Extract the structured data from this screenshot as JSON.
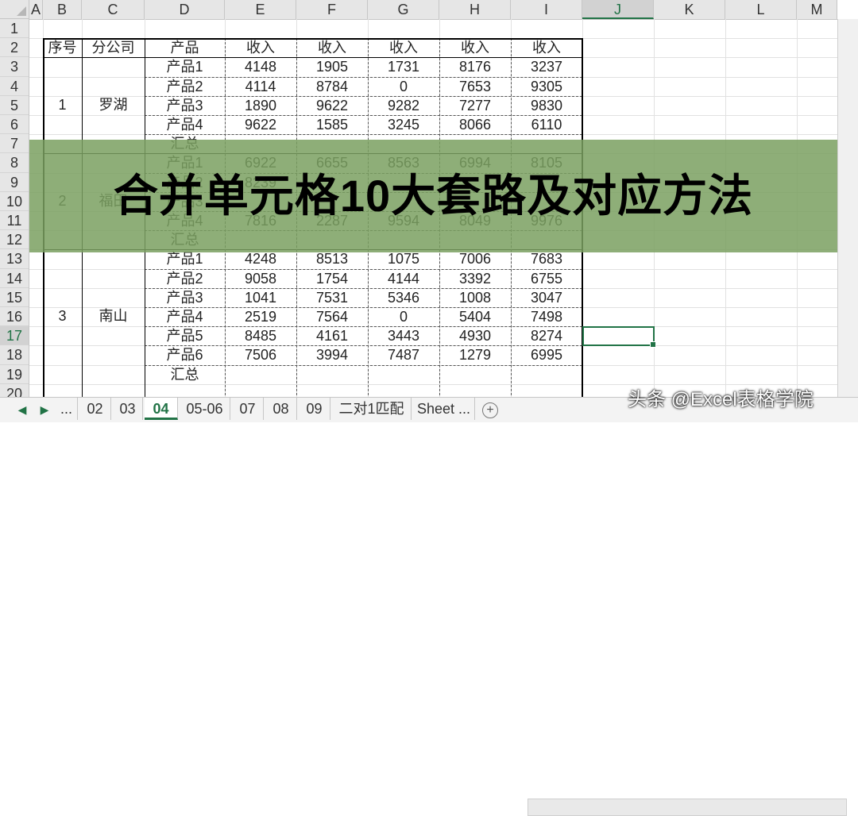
{
  "columns": [
    "A",
    "B",
    "C",
    "D",
    "E",
    "F",
    "G",
    "H",
    "I",
    "J",
    "K",
    "L",
    "M"
  ],
  "selected_column": "J",
  "rows": [
    "1",
    "2",
    "3",
    "4",
    "5",
    "6",
    "7",
    "8",
    "9",
    "10",
    "11",
    "12",
    "13",
    "14",
    "15",
    "16",
    "17",
    "18",
    "19",
    "20"
  ],
  "selected_row": "17",
  "table": {
    "headers": [
      "序号",
      "分公司",
      "产品",
      "收入",
      "收入",
      "收入",
      "收入",
      "收入"
    ],
    "groups": [
      {
        "seq": "1",
        "branch": "罗湖",
        "rows": [
          [
            "产品1",
            "4148",
            "1905",
            "1731",
            "8176",
            "3237"
          ],
          [
            "产品2",
            "4114",
            "8784",
            "0",
            "7653",
            "9305"
          ],
          [
            "产品3",
            "1890",
            "9622",
            "9282",
            "7277",
            "9830"
          ],
          [
            "产品4",
            "9622",
            "1585",
            "3245",
            "8066",
            "6110"
          ],
          [
            "汇总",
            "",
            "",
            "",
            "",
            ""
          ]
        ]
      },
      {
        "seq": "2",
        "branch": "福田",
        "rows": [
          [
            "产品1",
            "6922",
            "6655",
            "8563",
            "6994",
            "8105"
          ],
          [
            "产品2",
            "8239",
            "",
            "",
            "",
            ""
          ],
          [
            "产品3",
            "",
            "",
            "",
            "",
            ""
          ],
          [
            "产品4",
            "7816",
            "2287",
            "9594",
            "8049",
            "9976"
          ],
          [
            "汇总",
            "",
            "",
            "",
            "",
            ""
          ]
        ]
      },
      {
        "seq": "3",
        "branch": "南山",
        "rows": [
          [
            "产品1",
            "4248",
            "8513",
            "1075",
            "7006",
            "7683"
          ],
          [
            "产品2",
            "9058",
            "1754",
            "4144",
            "3392",
            "6755"
          ],
          [
            "产品3",
            "1041",
            "7531",
            "5346",
            "1008",
            "3047"
          ],
          [
            "产品4",
            "2519",
            "7564",
            "0",
            "5404",
            "7498"
          ],
          [
            "产品5",
            "8485",
            "4161",
            "3443",
            "4930",
            "8274"
          ],
          [
            "产品6",
            "7506",
            "3994",
            "7487",
            "1279",
            "6995"
          ],
          [
            "汇总",
            "",
            "",
            "",
            "",
            ""
          ]
        ]
      }
    ]
  },
  "banner": {
    "title": "合并单元格10大套路及对应方法"
  },
  "sheet_tabs": [
    "...",
    "02",
    "03",
    "04",
    "05-06",
    "07",
    "08",
    "09",
    "二对1匹配",
    "Sheet ..."
  ],
  "active_tab": "04",
  "nav": {
    "prev": "◀",
    "next": "▶",
    "add": "+"
  },
  "watermark": "头条 @Excel表格学院",
  "colors": {
    "banner": "#7aa060",
    "accent": "#217346"
  }
}
